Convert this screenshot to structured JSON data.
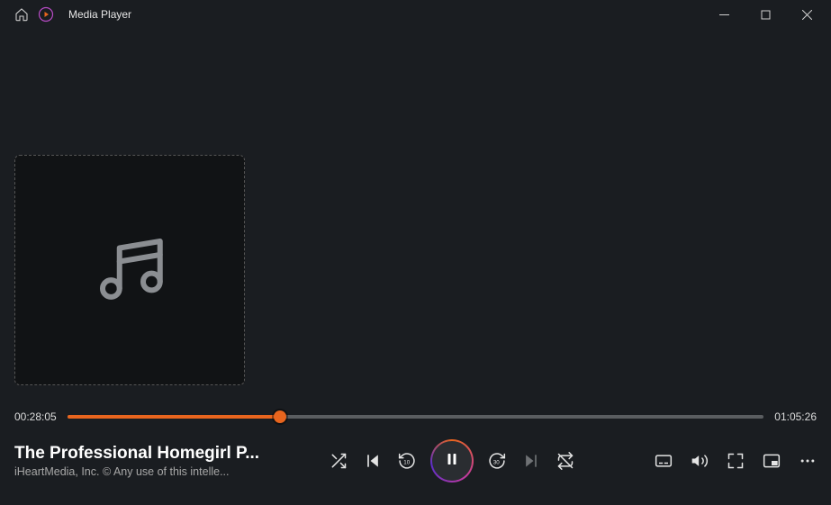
{
  "titlebar": {
    "app_name": "Media Player"
  },
  "playback": {
    "elapsed": "00:28:05",
    "total": "01:05:26",
    "progress_percent": 30.6
  },
  "track": {
    "title": "The Professional Homegirl P...",
    "subtitle": "iHeartMedia, Inc. © Any use of this intelle..."
  },
  "colors": {
    "accent": "#e8651e"
  }
}
